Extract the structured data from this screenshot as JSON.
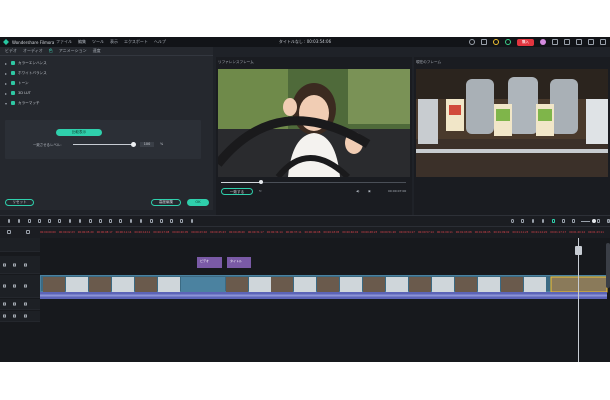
{
  "app": {
    "name": "Wondershare Filmora",
    "menu": [
      "ファイル",
      "編集",
      "ツール",
      "表示",
      "エクスポート",
      "ヘルプ"
    ],
    "document_title": "タイトルなし : 00:03:54:06",
    "buy_label": "購入"
  },
  "left_panel": {
    "tabs": [
      "ビデオ",
      "オーディオ",
      "色",
      "アニメーション",
      "速度"
    ],
    "active_tab": "色",
    "effects": [
      {
        "label": "カラーエンハンス"
      },
      {
        "label": "ホワイトバランス"
      },
      {
        "label": "トーン"
      },
      {
        "label": "3D LUT"
      },
      {
        "label": "カラーマッチ"
      }
    ],
    "auto_button": "比較表示",
    "slider": {
      "label": "一致させるレベル：",
      "value": "100",
      "unit": "%",
      "level": 1.0
    },
    "reset_button": "リセット",
    "advanced_button": "高度編集",
    "ok_button": "OK"
  },
  "preview": {
    "left_label": "リファレンスフレーム",
    "right_label": "現在のフレーム",
    "compare_button": "一致する",
    "time_left": "00:00:07:00"
  },
  "ruler": {
    "ticks": [
      "00:00:00:00",
      "00:00:02:23",
      "00:00:05:20",
      "00:00:08:17",
      "00:00:11:14",
      "00:00:14:11",
      "00:00:17:08",
      "00:00:20:05",
      "00:00:23:02",
      "00:00:25:23",
      "00:00:28:20",
      "00:00:31:17",
      "00:00:34:14",
      "00:00:37:11",
      "00:00:40:08",
      "00:00:43:05",
      "00:00:46:02",
      "00:00:48:23",
      "00:00:51:20",
      "00:00:54:17",
      "00:00:57:14",
      "00:01:00:11",
      "00:01:03:08",
      "00:01:06:05",
      "00:01:09:02",
      "00:01:11:23",
      "00:01:14:20",
      "00:01:17:17",
      "00:01:20:14",
      "00:01:23:11"
    ]
  },
  "timeline": {
    "title_clips": [
      "ビデオ",
      "タイトル"
    ]
  },
  "colors": {
    "accent": "#2fd0ac",
    "buy": "#e3353f",
    "ruler_text": "#e0444c",
    "audio_track": "#5c64b8"
  }
}
